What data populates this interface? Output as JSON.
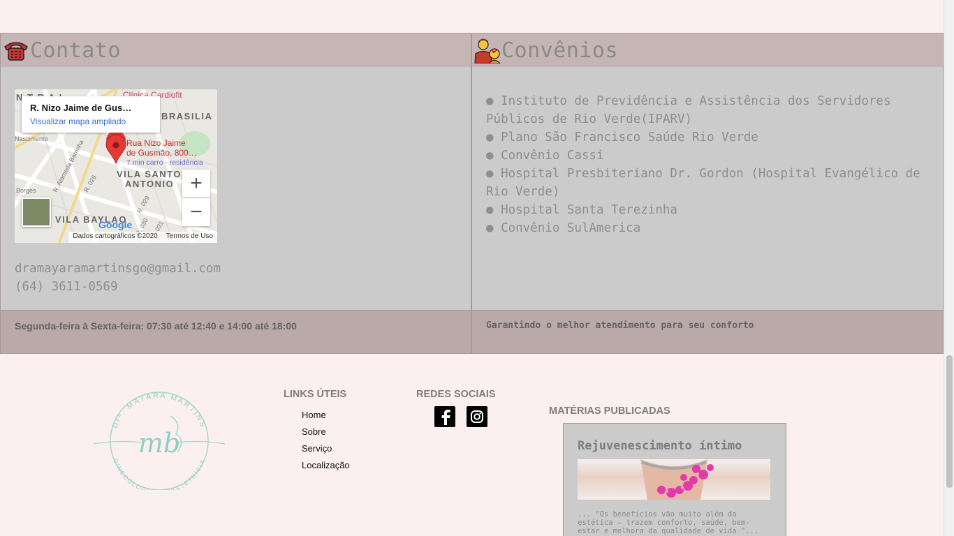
{
  "contato": {
    "title": "Contato",
    "icon": "telephone-icon",
    "map": {
      "place_title": "R. Nizo Jaime de Gus…",
      "enlarge_link": "Visualizar mapa ampliado",
      "pin_line1": "Rua Nizo Jaime",
      "pin_line2": "de Gusmão, 800…",
      "pin_sub": "7 min carro - residência",
      "labels": [
        "N T R A L",
        "Clínica Cardiofit",
        "BRASILIA",
        "Nascimento",
        "R. Alameda Barrinha",
        "VILA SANTO",
        "ANTONIO",
        "Borges",
        "R. 026",
        "R. 029",
        "VILA BAYLAO",
        "R. 030",
        "031"
      ],
      "zoom_in": "+",
      "zoom_out": "−",
      "attribution": "Dados cartográficos ©2020",
      "terms": "Termos de Uso",
      "brand": "Google"
    },
    "email": "dramayaramartinsgo@gmail.com",
    "phone": "(64) 3611-0569",
    "hours": "Segunda-feira à Sexta-feira: 07:30 até 12:40 e 14:00 até 18:00"
  },
  "convenios": {
    "title": "Convênios",
    "icon": "doctor-patient-icon",
    "items": [
      "● Instituto de Previdência e Assistência dos Servidores Públicos de Rio Verde(IPARV)",
      "● Plano São Francisco Saúde Rio Verde",
      "● Convênio Cassi",
      "● Hospital Presbiteriano Dr. Gordon (Hospital Evangélico de Rio Verde)",
      "● Hospital Santa Terezinha",
      "● Convênio SulAmerica"
    ],
    "footer": "Garantindo o melhor atendimento para seu conforto"
  },
  "footer": {
    "logo": {
      "top": "Drª. MAYARA MARTINS",
      "monogram": "mb",
      "bottom": "GINECOLOGIA E OBSTETRÍCIA"
    },
    "links_title": "LINKS ÚTEIS",
    "links": [
      "Home",
      "Sobre",
      "Serviço",
      "Localização"
    ],
    "social_title": "REDES SOCIAIS",
    "social": [
      "facebook-icon",
      "instagram-icon"
    ],
    "posts_title": "MATÉRIAS PUBLICADAS",
    "post": {
      "title": "Rejuvenescimento íntimo",
      "excerpt": "... \"Os benefícios vão muito além da estética – trazem conforto, saúde, bem-estar e melhora da qualidade de vida \"..."
    }
  },
  "colors": {
    "page_bg": "#fcefef",
    "card_bg": "#cbcbcb",
    "card_header": "#c6b5b5",
    "card_footer": "#b9a9a9",
    "logo_mint": "#9ed9cc"
  }
}
